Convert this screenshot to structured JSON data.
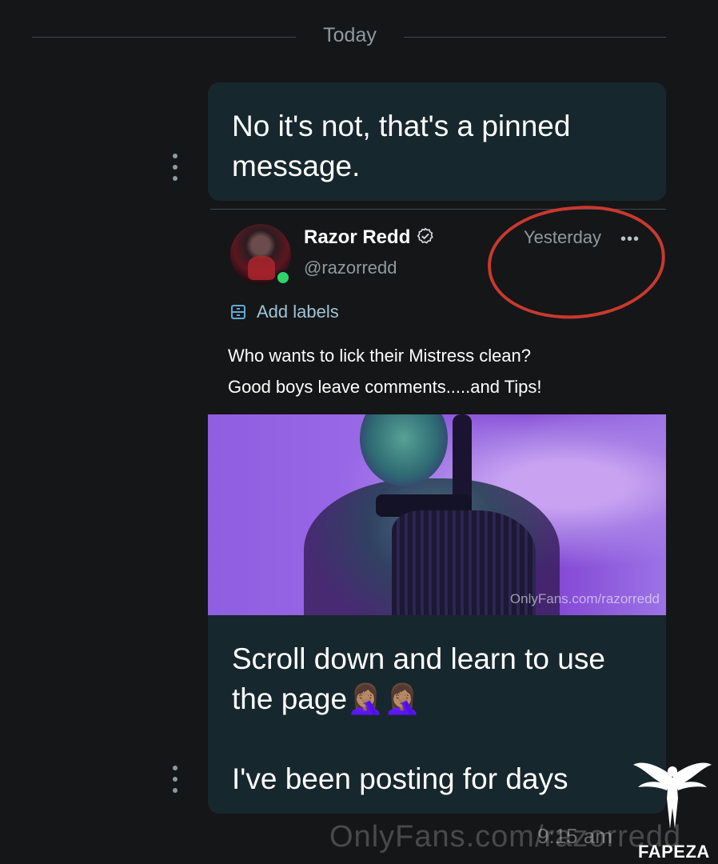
{
  "day_separator": "Today",
  "messages": [
    {
      "text": "No it's not, that's a pinned message."
    },
    {
      "text": "Scroll down and learn to use the page🤦🏽‍♀️🤦🏽‍♀️\n\nI've been posting for days"
    }
  ],
  "post": {
    "author_name": "Razor Redd",
    "author_handle": "@razorredd",
    "timestamp": "Yesterday",
    "more_icon": "ellipsis-icon",
    "add_labels": "Add labels",
    "caption": "Who wants to lick their Mistress clean?\nGood boys leave comments.....and Tips!",
    "media_watermark": "OnlyFans.com/razorredd"
  },
  "overlay": {
    "footer_watermark": "OnlyFans.com/razorredd",
    "footer_time": "9:15 am",
    "logo_text": "FAPEZA"
  },
  "colors": {
    "background": "#151617",
    "bubble": "#17272e",
    "annotation_circle": "#c8392f",
    "online": "#2fd46a",
    "link": "#9fc3d6"
  }
}
